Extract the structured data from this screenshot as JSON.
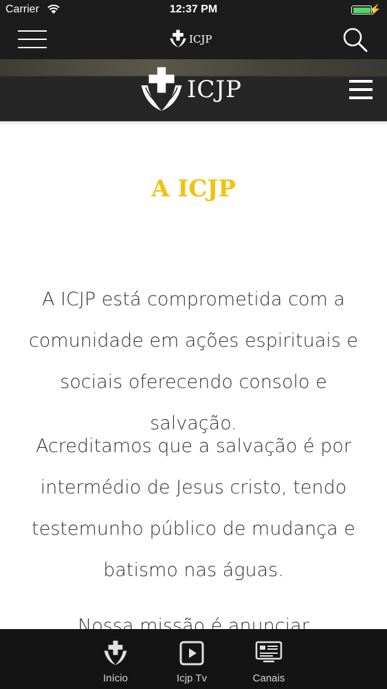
{
  "status_bar": {
    "carrier": "Carrier",
    "time": "12:37 PM"
  },
  "nav": {
    "logo_text": "ICJP"
  },
  "header": {
    "logo_text": "ICJP"
  },
  "content": {
    "title": "A ICJP",
    "paragraphs": [
      "A ICJP está comprometida com a comunidade em ações espirituais e sociais oferecendo consolo e salvação.",
      "Acreditamos que a salvação é por intermédio de Jesus cristo, tendo testemunho público de mudança e batismo nas águas.",
      "Nossa missão é anunciar"
    ]
  },
  "tabs": [
    {
      "label": "Início",
      "icon": "cross-wings-icon"
    },
    {
      "label": "Icjp Tv",
      "icon": "tv-play-icon"
    },
    {
      "label": "Canais",
      "icon": "channels-icon"
    }
  ],
  "colors": {
    "accent_yellow": "#f2c20f",
    "bar_dark": "#1c1c1c",
    "battery_green": "#4cd964"
  }
}
